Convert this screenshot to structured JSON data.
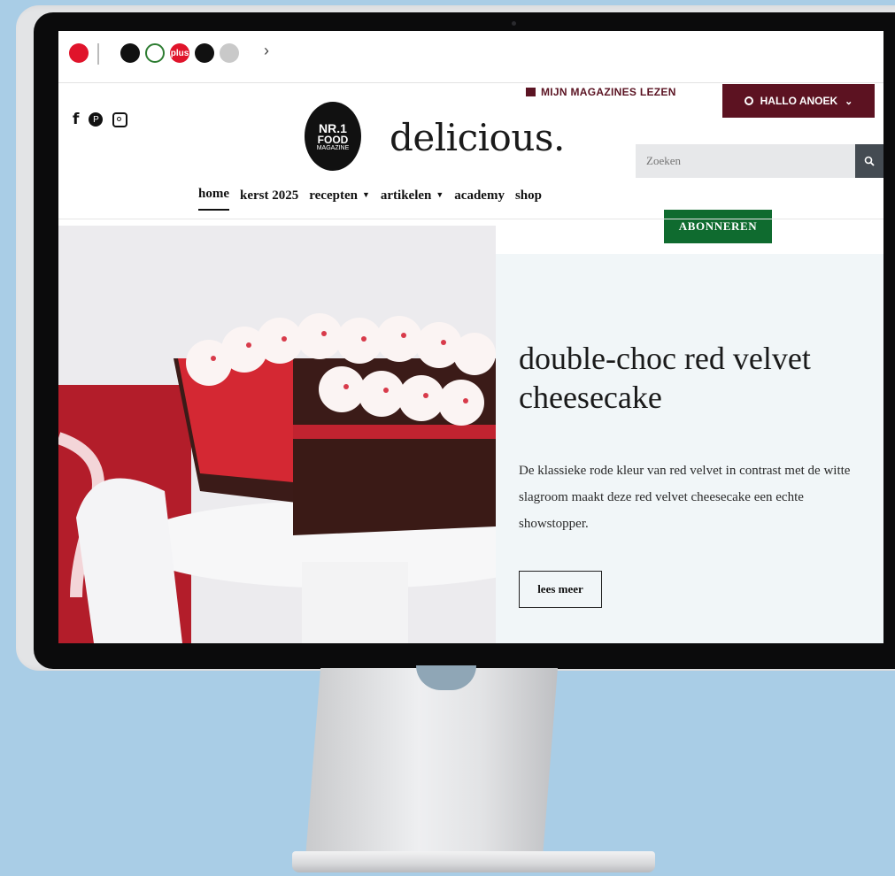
{
  "brands": [
    {
      "name": "brand-logo-1",
      "color": "#e0142b"
    },
    {
      "name": "brand-logo-2",
      "color": "#111111"
    },
    {
      "name": "brand-logo-3",
      "color": "#2e7d32"
    },
    {
      "name": "brand-logo-4",
      "color": "#e0142b",
      "text": "plus"
    },
    {
      "name": "brand-logo-5",
      "color": "#111111"
    },
    {
      "name": "brand-logo-6",
      "color": "#bdbdbd"
    }
  ],
  "header": {
    "magazines_link": "MIJN MAGAZINES LEZEN",
    "user_greeting": "HALLO ANOEK",
    "badge": {
      "line1": "NR.1",
      "line2": "FOOD",
      "line3": "MAGAZINE"
    },
    "logo": "delicious.",
    "search_placeholder": "Zoeken"
  },
  "nav": {
    "items": [
      {
        "label": "home",
        "active": true,
        "dropdown": false
      },
      {
        "label": "kerst 2025",
        "active": false,
        "dropdown": false
      },
      {
        "label": "recepten",
        "active": false,
        "dropdown": true
      },
      {
        "label": "artikelen",
        "active": false,
        "dropdown": true
      },
      {
        "label": "academy",
        "active": false,
        "dropdown": false
      },
      {
        "label": "shop",
        "active": false,
        "dropdown": false
      }
    ],
    "subscribe_label": "ABONNEREN"
  },
  "hero": {
    "title": "double-choc red velvet cheesecake",
    "description": "De klassieke rode kleur van red velvet in contrast met de witte slagroom maakt deze red velvet cheesecake een echte showstopper.",
    "button_label": "lees meer"
  },
  "colors": {
    "brand_accent": "#5c1221",
    "subscribe_green": "#0f6b2f",
    "hero_panel": "#f1f6f8",
    "background": "#a9cde6"
  }
}
